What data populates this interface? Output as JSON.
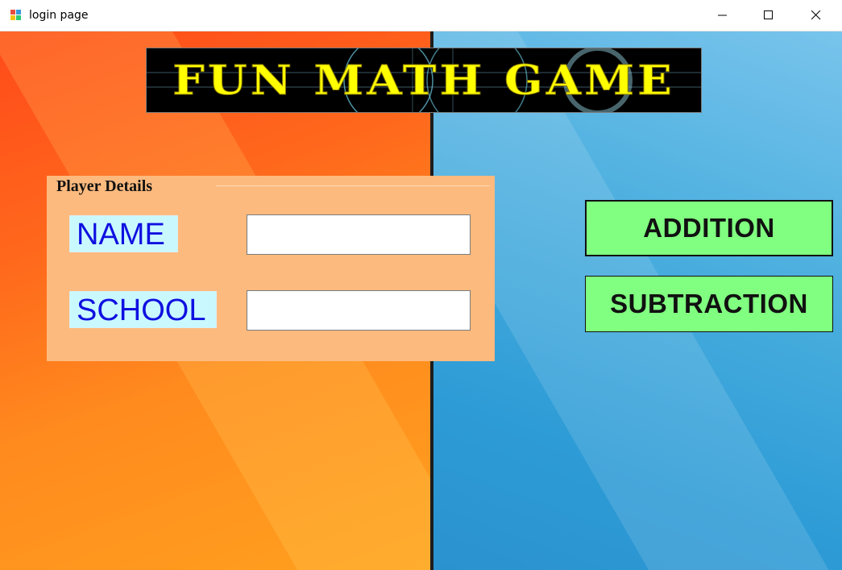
{
  "window": {
    "title": "login page",
    "icons": {
      "app": "app-icon",
      "minimize": "minimize-icon",
      "maximize": "maximize-icon",
      "close": "close-icon"
    }
  },
  "banner": {
    "text": "FUN MATH GAME",
    "color": "#ffff00"
  },
  "player_details": {
    "legend": "Player Details",
    "name_label": "NAME",
    "name_value": "",
    "school_label": "SCHOOL",
    "school_value": ""
  },
  "actions": {
    "addition_label": "ADDITION",
    "subtraction_label": "SUBTRACTION",
    "button_color": "#80ff80"
  },
  "colors": {
    "left_background": "#ff6a1c",
    "right_background": "#3aa6da",
    "group_background": "#fdba7e",
    "label_background": "#c9f9ff",
    "label_text": "#1010e0"
  }
}
